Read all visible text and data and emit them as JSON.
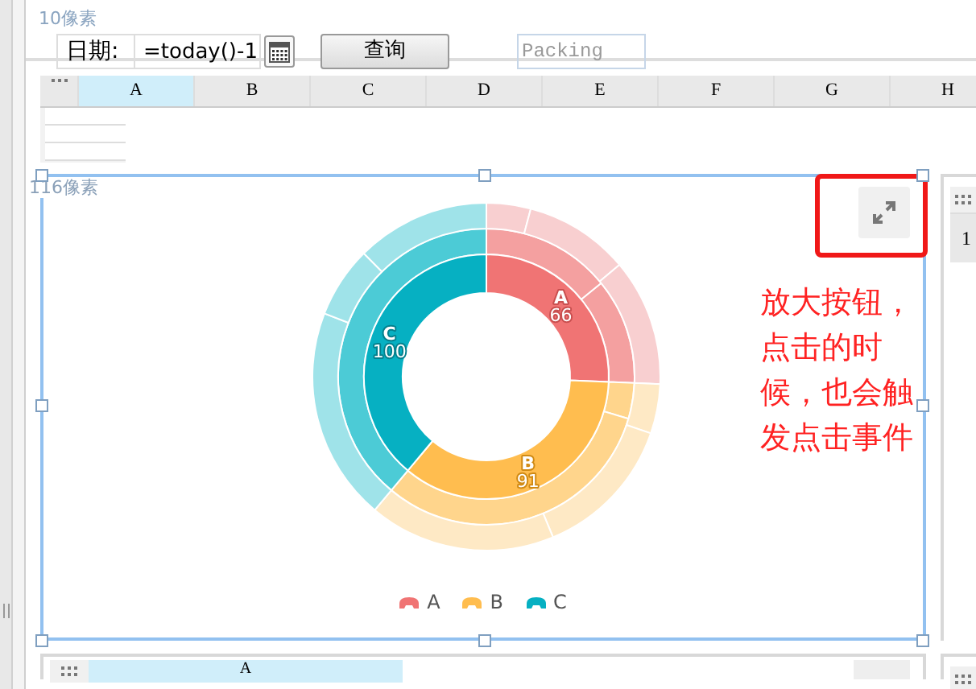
{
  "top_label": "10像素",
  "toolbar": {
    "date_label": "日期:",
    "date_field": {
      "value": "=today()-1"
    },
    "query_button": "查询",
    "packing_field": {
      "placeholder": "Packing"
    }
  },
  "sheet": {
    "columns": [
      {
        "label": "A",
        "selected": true
      },
      {
        "label": "B",
        "selected": false
      },
      {
        "label": "C",
        "selected": false
      },
      {
        "label": "D",
        "selected": false
      },
      {
        "label": "E",
        "selected": false
      },
      {
        "label": "F",
        "selected": false
      },
      {
        "label": "G",
        "selected": false
      },
      {
        "label": "H",
        "selected": false
      }
    ]
  },
  "chart_widget": {
    "size_label": "116像素",
    "chart_data": {
      "type": "donut",
      "categories": [
        "A",
        "B",
        "C"
      ],
      "values": [
        66,
        91,
        100
      ],
      "data_labels": true
    },
    "legend": [
      "A",
      "B",
      "C"
    ],
    "annotation": "放大按钮，点击的时候，也会触发点击事件"
  },
  "side_panel": {
    "cell": "1"
  },
  "bottom_panel": {
    "columns": [
      {
        "label": "A",
        "selected": true
      }
    ]
  }
}
